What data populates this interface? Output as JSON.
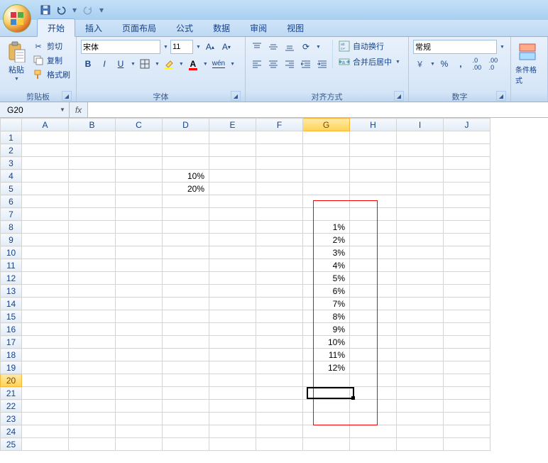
{
  "qat": {
    "save": "save",
    "undo": "undo",
    "redo": "redo"
  },
  "tabs": {
    "home": "开始",
    "insert": "插入",
    "layout": "页面布局",
    "formulas": "公式",
    "data": "数据",
    "review": "审阅",
    "view": "视图"
  },
  "clipboard": {
    "paste": "粘贴",
    "cut": "剪切",
    "copy": "复制",
    "fmt": "格式刷",
    "label": "剪贴板"
  },
  "font": {
    "name": "宋体",
    "size": "11",
    "label": "字体",
    "bold": "B",
    "italic": "I",
    "underline": "U"
  },
  "align": {
    "label": "对齐方式",
    "wrap": "自动换行",
    "merge": "合并后居中"
  },
  "number": {
    "label": "数字",
    "format": "常规",
    "pct": "%",
    "comma": ",",
    "dec_inc": ".0",
    "dec_dec": ".00"
  },
  "styles": {
    "cond": "条件格式"
  },
  "namebox": "G20",
  "fx": "fx",
  "columns": [
    "A",
    "B",
    "C",
    "D",
    "E",
    "F",
    "G",
    "H",
    "I",
    "J"
  ],
  "rows": [
    "1",
    "2",
    "3",
    "4",
    "5",
    "6",
    "7",
    "8",
    "9",
    "10",
    "11",
    "12",
    "13",
    "14",
    "15",
    "16",
    "17",
    "18",
    "19",
    "20",
    "21",
    "22",
    "23",
    "24",
    "25"
  ],
  "cells": {
    "D4": "10%",
    "D5": "20%",
    "G8": "1%",
    "G9": "2%",
    "G10": "3%",
    "G11": "4%",
    "G12": "5%",
    "G13": "6%",
    "G14": "7%",
    "G15": "8%",
    "G16": "9%",
    "G17": "10%",
    "G18": "11%",
    "G19": "12%"
  },
  "chart_data": {
    "type": "table",
    "series": [
      {
        "name": "D",
        "values": [
          "10%",
          "20%"
        ],
        "rows": [
          4,
          5
        ]
      },
      {
        "name": "G",
        "values": [
          "1%",
          "2%",
          "3%",
          "4%",
          "5%",
          "6%",
          "7%",
          "8%",
          "9%",
          "10%",
          "11%",
          "12%"
        ],
        "rows": [
          8,
          9,
          10,
          11,
          12,
          13,
          14,
          15,
          16,
          17,
          18,
          19
        ]
      }
    ]
  }
}
